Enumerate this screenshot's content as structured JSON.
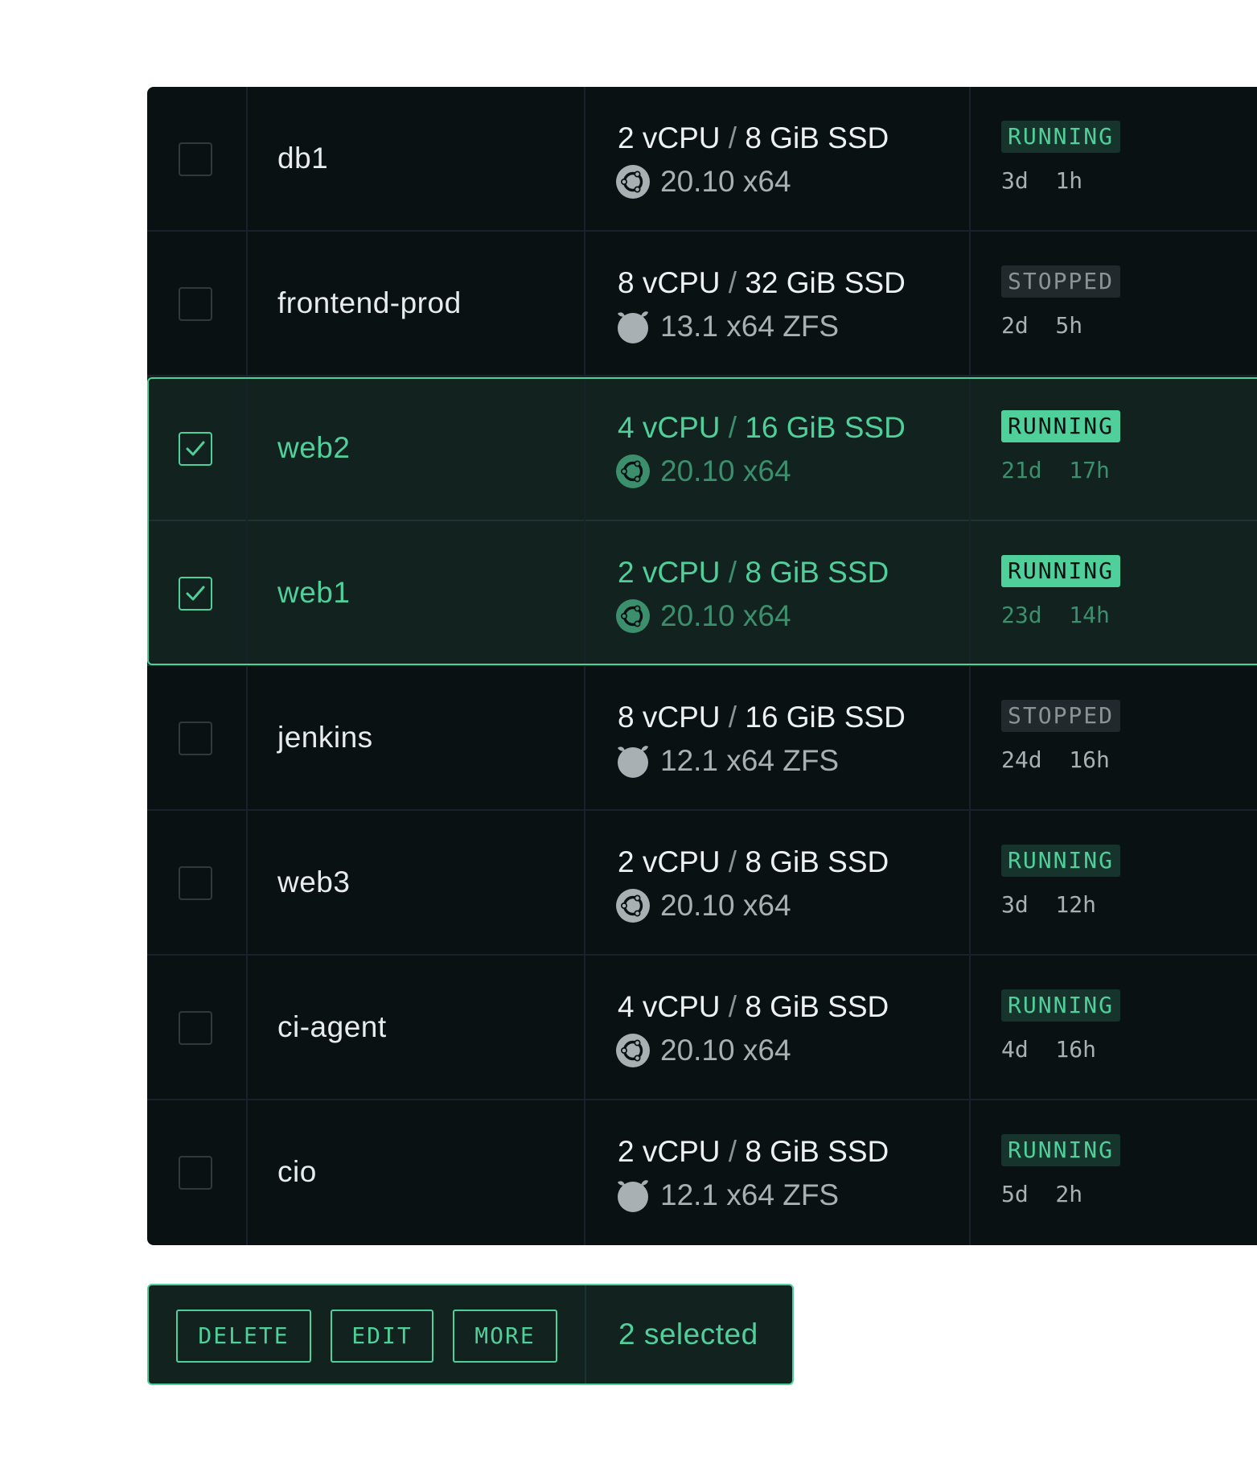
{
  "colors": {
    "accent": "#4fd09a",
    "table_bg": "#0a1113",
    "selected_row_bg": "#12221f",
    "muted_text": "#a9b0b3"
  },
  "rows": [
    {
      "name": "db1",
      "cpu": "2 vCPU",
      "disk": "8 GiB SSD",
      "os_icon": "ubuntu-icon",
      "os": "20.10 x64",
      "status": "RUNNING",
      "uptime": "3d  1h",
      "selected": false
    },
    {
      "name": "frontend-prod",
      "cpu": "8 vCPU",
      "disk": "32 GiB SSD",
      "os_icon": "freebsd-icon",
      "os": "13.1 x64 ZFS",
      "status": "STOPPED",
      "uptime": "2d  5h",
      "selected": false
    },
    {
      "name": "web2",
      "cpu": "4 vCPU",
      "disk": "16 GiB SSD",
      "os_icon": "ubuntu-icon",
      "os": "20.10 x64",
      "status": "RUNNING",
      "uptime": "21d  17h",
      "selected": true
    },
    {
      "name": "web1",
      "cpu": "2 vCPU",
      "disk": "8 GiB SSD",
      "os_icon": "ubuntu-icon",
      "os": "20.10 x64",
      "status": "RUNNING",
      "uptime": "23d  14h",
      "selected": true
    },
    {
      "name": "jenkins",
      "cpu": "8 vCPU",
      "disk": "16 GiB SSD",
      "os_icon": "freebsd-icon",
      "os": "12.1 x64 ZFS",
      "status": "STOPPED",
      "uptime": "24d  16h",
      "selected": false
    },
    {
      "name": "web3",
      "cpu": "2 vCPU",
      "disk": "8 GiB SSD",
      "os_icon": "ubuntu-icon",
      "os": "20.10 x64",
      "status": "RUNNING",
      "uptime": "3d  12h",
      "selected": false
    },
    {
      "name": "ci-agent",
      "cpu": "4 vCPU",
      "disk": "8 GiB SSD",
      "os_icon": "ubuntu-icon",
      "os": "20.10 x64",
      "status": "RUNNING",
      "uptime": "4d  16h",
      "selected": false
    },
    {
      "name": "cio",
      "cpu": "2 vCPU",
      "disk": "8 GiB SSD",
      "os_icon": "freebsd-icon",
      "os": "12.1 x64 ZFS",
      "status": "RUNNING",
      "uptime": "5d  2h",
      "selected": false
    }
  ],
  "actions": {
    "delete_label": "DELETE",
    "edit_label": "EDIT",
    "more_label": "MORE",
    "selected_count": "2 selected"
  }
}
